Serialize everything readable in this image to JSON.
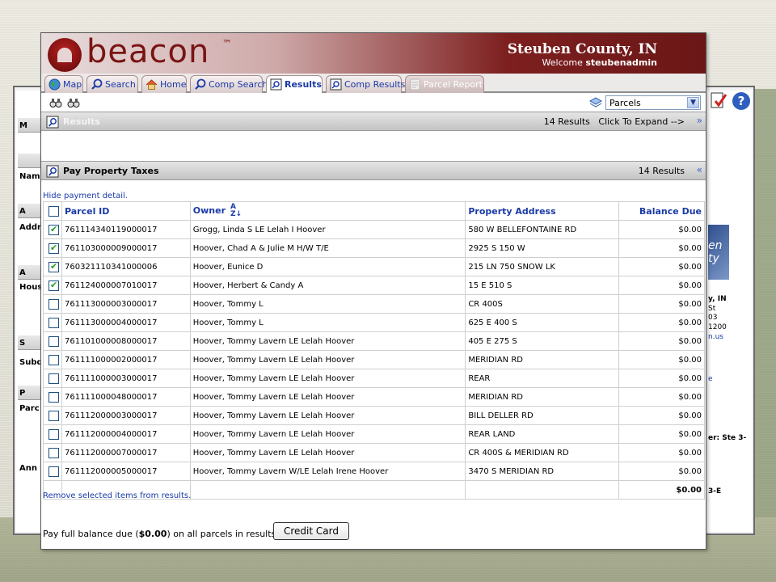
{
  "app": {
    "logo_text": "beacon",
    "logo_tm": "™",
    "county": "Steuben County, IN",
    "welcome_prefix": "Welcome ",
    "username": "steubenadmin"
  },
  "tabs": [
    {
      "label": "Map",
      "icon": "globe-icon"
    },
    {
      "label": "Search",
      "icon": "magnifier-icon"
    },
    {
      "label": "Home",
      "icon": "house-icon"
    },
    {
      "label": "Comp Search",
      "icon": "magnifier-icon"
    },
    {
      "label": "Results",
      "icon": "results-icon",
      "active": true
    },
    {
      "label": "Comp Results",
      "icon": "results-icon"
    },
    {
      "label": "Parcel Report",
      "icon": "report-icon",
      "disabled": true
    }
  ],
  "toolbar": {
    "layer_select": "Parcels",
    "layer_options": [
      "Parcels"
    ]
  },
  "results_panel": {
    "title": "Results",
    "count": "14 Results",
    "expand_text": "Click To Expand -->"
  },
  "taxes_panel": {
    "title": "Pay Property Taxes",
    "count": "14 Results",
    "hide_link": "Hide payment detail.",
    "remove_link": "Remove selected items from results.",
    "pay_text_prefix": "Pay full balance due (",
    "pay_amount": "$0.00",
    "pay_text_suffix": ") on all parcels in results list by",
    "credit_button": "Credit Card"
  },
  "table": {
    "headers": {
      "parcel_id": "Parcel ID",
      "owner": "Owner",
      "address": "Property Address",
      "balance": "Balance Due"
    },
    "sort_icon": "A Z",
    "rows": [
      {
        "checked": true,
        "parcel": "761114340119000017",
        "owner": "Grogg, Linda S LE Lelah I Hoover",
        "address": "580 W BELLEFONTAINE RD",
        "balance": "$0.00"
      },
      {
        "checked": true,
        "parcel": "761103000009000017",
        "owner": "Hoover, Chad A & Julie M H/W T/E",
        "address": "2925 S 150 W",
        "balance": "$0.00"
      },
      {
        "checked": true,
        "parcel": "760321110341000006",
        "owner": "Hoover, Eunice D",
        "address": "215 LN 750 SNOW LK",
        "balance": "$0.00"
      },
      {
        "checked": true,
        "parcel": "761124000007010017",
        "owner": "Hoover, Herbert & Candy A",
        "address": "15 E 510 S",
        "balance": "$0.00"
      },
      {
        "checked": false,
        "parcel": "761113000003000017",
        "owner": "Hoover, Tommy L",
        "address": "CR 400S",
        "balance": "$0.00"
      },
      {
        "checked": false,
        "parcel": "761113000004000017",
        "owner": "Hoover, Tommy L",
        "address": "625 E 400 S",
        "balance": "$0.00"
      },
      {
        "checked": false,
        "parcel": "761101000008000017",
        "owner": "Hoover, Tommy Lavern LE Lelah Hoover",
        "address": "405 E 275 S",
        "balance": "$0.00"
      },
      {
        "checked": false,
        "parcel": "761111000002000017",
        "owner": "Hoover, Tommy Lavern LE Lelah Hoover",
        "address": "MERIDIAN RD",
        "balance": "$0.00"
      },
      {
        "checked": false,
        "parcel": "761111000003000017",
        "owner": "Hoover, Tommy Lavern LE Lelah Hoover",
        "address": "REAR",
        "balance": "$0.00"
      },
      {
        "checked": false,
        "parcel": "761111000048000017",
        "owner": "Hoover, Tommy Lavern LE Lelah Hoover",
        "address": "MERIDIAN RD",
        "balance": "$0.00"
      },
      {
        "checked": false,
        "parcel": "761112000003000017",
        "owner": "Hoover, Tommy Lavern LE Lelah Hoover",
        "address": "BILL DELLER RD",
        "balance": "$0.00"
      },
      {
        "checked": false,
        "parcel": "761112000004000017",
        "owner": "Hoover, Tommy Lavern LE Lelah Hoover",
        "address": "REAR LAND",
        "balance": "$0.00"
      },
      {
        "checked": false,
        "parcel": "761112000007000017",
        "owner": "Hoover, Tommy Lavern LE Lelah Hoover",
        "address": "CR 400S & MERIDIAN RD",
        "balance": "$0.00"
      },
      {
        "checked": false,
        "parcel": "761112000005000017",
        "owner": "Hoover, Tommy Lavern W/LE Lelah Irene Hoover",
        "address": "3470 S MERIDIAN RD",
        "balance": "$0.00"
      }
    ],
    "total": "$0.00"
  },
  "background": {
    "right_texts": [
      "y, IN",
      "St",
      "03",
      "1200",
      "n.us",
      "e",
      "er: Ste 3-",
      "3-E"
    ],
    "right_logo": "en ty",
    "left_labels": [
      "M",
      "Nam",
      "A",
      "Addr",
      "A",
      "Hous",
      "S",
      "Subd",
      "P",
      "Parc",
      "Ann"
    ]
  }
}
